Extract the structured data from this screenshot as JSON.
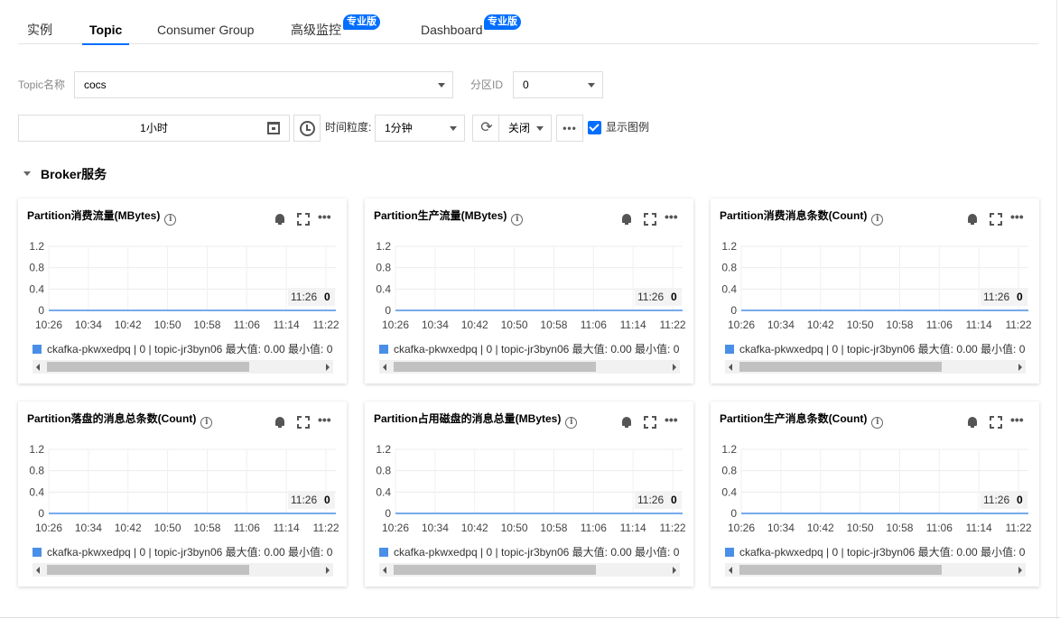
{
  "tabs": [
    {
      "label": "实例",
      "badge": ""
    },
    {
      "label": "Topic",
      "badge": "",
      "active": true
    },
    {
      "label": "Consumer Group",
      "badge": ""
    },
    {
      "label": "高级监控",
      "badge": "专业版"
    },
    {
      "label": "Dashboard",
      "badge": "专业版"
    }
  ],
  "filters": {
    "topic_label": "Topic名称",
    "topic_value": "cocs",
    "partition_label": "分区ID",
    "partition_value": "0",
    "time_range": "1小时",
    "granularity_label": "时间粒度:",
    "granularity_value": "1分钟",
    "refresh_value": "关闭",
    "more_label": "•••",
    "show_legend_label": "显示图例",
    "show_legend_checked": true
  },
  "section": {
    "title": "Broker服务"
  },
  "icons": {
    "calendar": "calendar-icon",
    "clock": "clock-icon",
    "refresh": "refresh-icon",
    "bell": "bell-icon",
    "fullscreen": "fullscreen-icon",
    "more": "more-icon",
    "info": "info-icon"
  },
  "colors": {
    "accent": "#006eff",
    "series": "#4a8fe7"
  },
  "chart_data": [
    {
      "type": "line",
      "title": "Partition消费流量(MBytes)",
      "x": [
        "10:26",
        "10:34",
        "10:42",
        "10:50",
        "10:58",
        "11:06",
        "11:14",
        "11:22"
      ],
      "yticks": [
        "1.2",
        "0.8",
        "0.4",
        "0"
      ],
      "ylim": [
        0,
        1.2
      ],
      "series": [
        {
          "name": "ckafka-pkwxedpq | 0 | topic-jr3byn06",
          "values": [
            0,
            0,
            0,
            0,
            0,
            0,
            0,
            0
          ]
        }
      ],
      "tooltip_time": "11:26",
      "tooltip_value": "0",
      "legend_text": "ckafka-pkwxedpq | 0 | topic-jr3byn06 最大值: 0.00 最小值: 0"
    },
    {
      "type": "line",
      "title": "Partition生产流量(MBytes)",
      "x": [
        "10:26",
        "10:34",
        "10:42",
        "10:50",
        "10:58",
        "11:06",
        "11:14",
        "11:22"
      ],
      "yticks": [
        "1.2",
        "0.8",
        "0.4",
        "0"
      ],
      "ylim": [
        0,
        1.2
      ],
      "series": [
        {
          "name": "ckafka-pkwxedpq | 0 | topic-jr3byn06",
          "values": [
            0,
            0,
            0,
            0,
            0,
            0,
            0,
            0
          ]
        }
      ],
      "tooltip_time": "11:26",
      "tooltip_value": "0",
      "legend_text": "ckafka-pkwxedpq | 0 | topic-jr3byn06 最大值: 0.00 最小值: 0"
    },
    {
      "type": "line",
      "title": "Partition消费消息条数(Count)",
      "x": [
        "10:26",
        "10:34",
        "10:42",
        "10:50",
        "10:58",
        "11:06",
        "11:14",
        "11:22"
      ],
      "yticks": [
        "1.2",
        "0.8",
        "0.4",
        "0"
      ],
      "ylim": [
        0,
        1.2
      ],
      "series": [
        {
          "name": "ckafka-pkwxedpq | 0 | topic-jr3byn06",
          "values": [
            0,
            0,
            0,
            0,
            0,
            0,
            0,
            0
          ]
        }
      ],
      "tooltip_time": "11:26",
      "tooltip_value": "0",
      "legend_text": "ckafka-pkwxedpq | 0 | topic-jr3byn06 最大值: 0.00 最小值: 0"
    },
    {
      "type": "line",
      "title": "Partition落盘的消息总条数(Count)",
      "x": [
        "10:26",
        "10:34",
        "10:42",
        "10:50",
        "10:58",
        "11:06",
        "11:14",
        "11:22"
      ],
      "yticks": [
        "1.2",
        "0.8",
        "0.4",
        "0"
      ],
      "ylim": [
        0,
        1.2
      ],
      "series": [
        {
          "name": "ckafka-pkwxedpq | 0 | topic-jr3byn06",
          "values": [
            0,
            0,
            0,
            0,
            0,
            0,
            0,
            0
          ]
        }
      ],
      "tooltip_time": "11:26",
      "tooltip_value": "0",
      "legend_text": "ckafka-pkwxedpq | 0 | topic-jr3byn06 最大值: 0.00 最小值: 0"
    },
    {
      "type": "line",
      "title": "Partition占用磁盘的消息总量(MBytes)",
      "x": [
        "10:26",
        "10:34",
        "10:42",
        "10:50",
        "10:58",
        "11:06",
        "11:14",
        "11:22"
      ],
      "yticks": [
        "1.2",
        "0.8",
        "0.4",
        "0"
      ],
      "ylim": [
        0,
        1.2
      ],
      "series": [
        {
          "name": "ckafka-pkwxedpq | 0 | topic-jr3byn06",
          "values": [
            0,
            0,
            0,
            0,
            0,
            0,
            0,
            0
          ]
        }
      ],
      "tooltip_time": "11:26",
      "tooltip_value": "0",
      "legend_text": "ckafka-pkwxedpq | 0 | topic-jr3byn06 最大值: 0.00 最小值: 0"
    },
    {
      "type": "line",
      "title": "Partition生产消息条数(Count)",
      "x": [
        "10:26",
        "10:34",
        "10:42",
        "10:50",
        "10:58",
        "11:06",
        "11:14",
        "11:22"
      ],
      "yticks": [
        "1.2",
        "0.8",
        "0.4",
        "0"
      ],
      "ylim": [
        0,
        1.2
      ],
      "series": [
        {
          "name": "ckafka-pkwxedpq | 0 | topic-jr3byn06",
          "values": [
            0,
            0,
            0,
            0,
            0,
            0,
            0,
            0
          ]
        }
      ],
      "tooltip_time": "11:26",
      "tooltip_value": "0",
      "legend_text": "ckafka-pkwxedpq | 0 | topic-jr3byn06 最大值: 0.00 最小值: 0"
    }
  ]
}
